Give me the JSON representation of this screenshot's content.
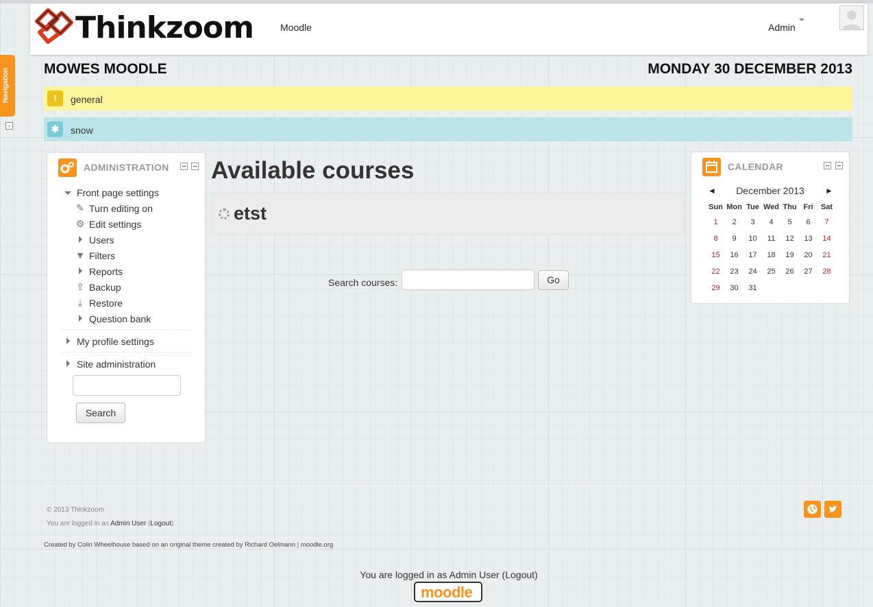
{
  "header": {
    "logo_text": "Thinkzoom",
    "nav_link": "Moodle",
    "user_menu": "Admin"
  },
  "nav_tab": {
    "label": "Navigation"
  },
  "page": {
    "site_title": "MOWES MOODLE",
    "date": "MONDAY 30 DECEMBER 2013"
  },
  "alerts": [
    {
      "icon": "!",
      "text": "general"
    },
    {
      "icon": "✱",
      "text": "snow"
    }
  ],
  "admin_block": {
    "title": "ADMINISTRATION",
    "front_page_settings": "Front page settings",
    "items": [
      {
        "label": "Turn editing on",
        "icon": "pencil-icon"
      },
      {
        "label": "Edit settings",
        "icon": "gear-icon"
      },
      {
        "label": "Users",
        "icon": "expand-arrow-icon"
      },
      {
        "label": "Filters",
        "icon": "filter-icon"
      },
      {
        "label": "Reports",
        "icon": "expand-arrow-icon"
      },
      {
        "label": "Backup",
        "icon": "upload-icon"
      },
      {
        "label": "Restore",
        "icon": "download-icon"
      },
      {
        "label": "Question bank",
        "icon": "expand-arrow-icon"
      }
    ],
    "my_profile": "My profile settings",
    "site_admin": "Site administration",
    "search_button": "Search"
  },
  "main": {
    "heading": "Available courses",
    "course_name": "etst",
    "search_label": "Search courses:",
    "go_button": "Go"
  },
  "calendar": {
    "title": "CALENDAR",
    "prev": "◄",
    "next": "►",
    "month": "December 2013",
    "weekdays": [
      "Sun",
      "Mon",
      "Tue",
      "Wed",
      "Thu",
      "Fri",
      "Sat"
    ],
    "weeks": [
      [
        "1",
        "2",
        "3",
        "4",
        "5",
        "6",
        "7"
      ],
      [
        "8",
        "9",
        "10",
        "11",
        "12",
        "13",
        "14"
      ],
      [
        "15",
        "16",
        "17",
        "18",
        "19",
        "20",
        "21"
      ],
      [
        "22",
        "23",
        "24",
        "25",
        "26",
        "27",
        "28"
      ],
      [
        "29",
        "30",
        "31",
        "",
        "",
        "",
        ""
      ]
    ]
  },
  "footer": {
    "copyright": "© 2013 Thinkzoom",
    "logged_in_prefix": "You are logged in as",
    "user_link": "Admin User",
    "logout_link": "Logout",
    "credits": "Created by Colin Wheelhouse based on an original theme created by Richard Oelmann | moodle.org",
    "bottom_login": "You are logged in as Admin User (Logout)",
    "moodle_logo": "moodle"
  },
  "colors": {
    "accent": "#f7941d",
    "alert_yellow": "#fdf59a",
    "alert_blue": "#bde3ea",
    "weekend_red": "#c02020"
  }
}
